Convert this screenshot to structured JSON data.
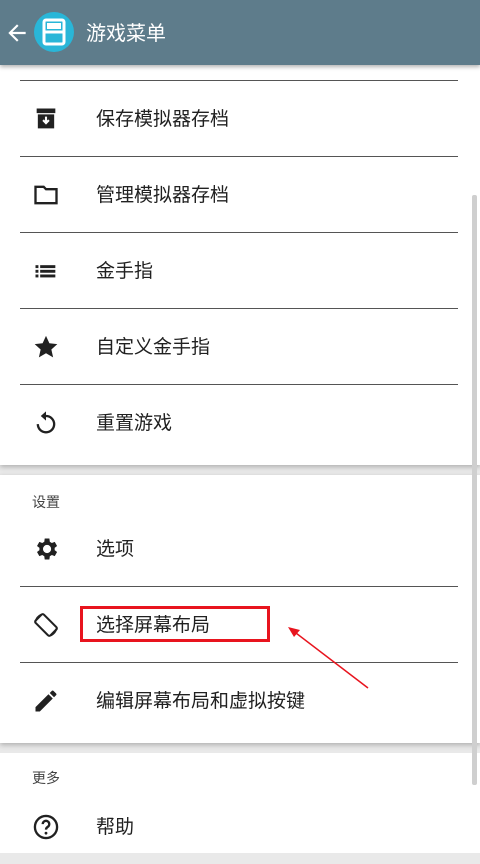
{
  "appbar": {
    "title": "游戏菜单",
    "back_icon": "arrow-left-icon",
    "logo_icon": "ds-logo-icon"
  },
  "menu": [
    {
      "label": "保存模拟器存档",
      "icon": "save-archive-icon"
    },
    {
      "label": "管理模拟器存档",
      "icon": "folder-icon"
    },
    {
      "label": "金手指",
      "icon": "list-icon"
    },
    {
      "label": "自定义金手指",
      "icon": "star-icon"
    },
    {
      "label": "重置游戏",
      "icon": "reset-icon"
    }
  ],
  "settings": {
    "header": "设置",
    "items": [
      {
        "label": "选项",
        "icon": "gear-icon"
      },
      {
        "label": "选择屏幕布局",
        "icon": "screen-rotation-icon"
      },
      {
        "label": "编辑屏幕布局和虚拟按键",
        "icon": "pencil-icon"
      }
    ]
  },
  "more": {
    "header": "更多",
    "items": [
      {
        "label": "帮助",
        "icon": "help-icon"
      }
    ]
  },
  "colors": {
    "appbar": "#5e7c8b",
    "logo": "#29b6d8",
    "highlight": "#e8141e"
  }
}
